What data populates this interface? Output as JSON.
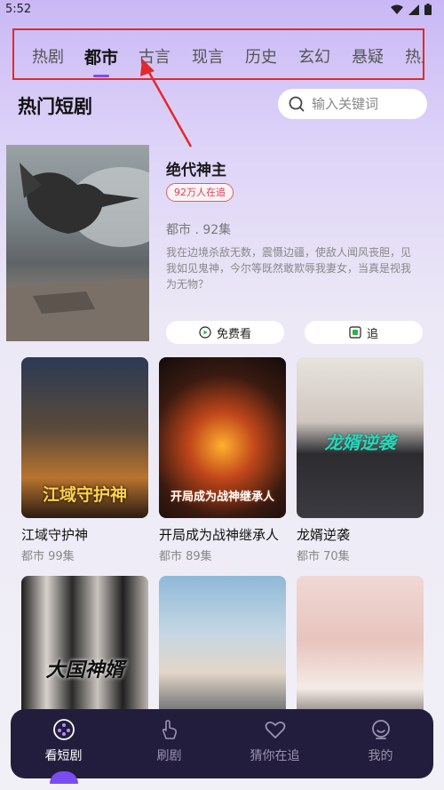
{
  "status_bar": {
    "time": "5:52"
  },
  "category_tabs": [
    "热剧",
    "都市",
    "古言",
    "现言",
    "历史",
    "玄幻",
    "悬疑",
    "热血"
  ],
  "active_tab": "都市",
  "section": {
    "title": "热门短剧"
  },
  "search": {
    "placeholder": "输入关键词"
  },
  "featured": {
    "title": "绝代神主",
    "badge": "92万人在追",
    "meta": "都市 . 92集",
    "description": "我在边境杀敌无数，震慑边疆，使敌人闻风丧胆，见我如见鬼神，今尔等既然敢欺辱我妻女，当真是视我为无物？",
    "watch_free_label": "免费看",
    "follow_label": "追"
  },
  "dramas": [
    {
      "title": "江域守护神",
      "meta": "都市  99集",
      "cover_text": "江域守护神"
    },
    {
      "title": "开局成为战神继承人",
      "meta": "都市  89集",
      "cover_text": "开局成为战神继承人"
    },
    {
      "title": "龙婿逆袭",
      "meta": "都市  70集",
      "cover_text": "龙婿逆袭"
    },
    {
      "title": "",
      "meta": "",
      "cover_text": "大国神婿"
    },
    {
      "title": "",
      "meta": "",
      "cover_text": ""
    },
    {
      "title": "",
      "meta": "",
      "cover_text": ""
    }
  ],
  "bottom_nav": [
    {
      "label": "看短剧",
      "icon": "film-reel-icon",
      "active": true
    },
    {
      "label": "刷剧",
      "icon": "swipe-hand-icon",
      "active": false
    },
    {
      "label": "猜你在追",
      "icon": "heart-icon",
      "active": false
    },
    {
      "label": "我的",
      "icon": "smile-face-icon",
      "active": false
    }
  ],
  "colors": {
    "accent": "#7b4cf0",
    "annotation": "#e32929",
    "badge": "#e03c55",
    "nav_bg": "#231d3d"
  }
}
